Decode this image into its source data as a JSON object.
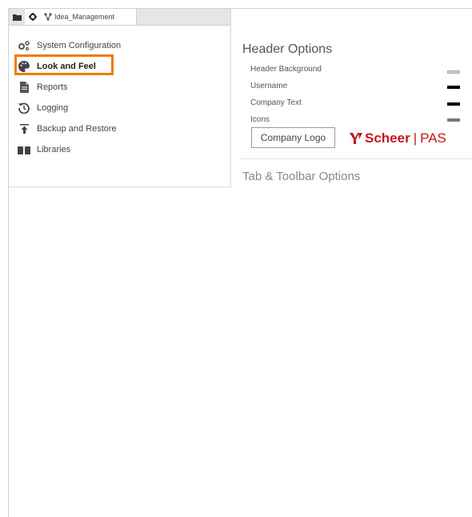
{
  "tabs": {
    "project_tab_label": "Idea_Management"
  },
  "sidebar": {
    "items": [
      {
        "label": "System Configuration",
        "icon": "gears-icon"
      },
      {
        "label": "Look and Feel",
        "icon": "palette-icon",
        "active": true
      },
      {
        "label": "Reports",
        "icon": "document-icon"
      },
      {
        "label": "Logging",
        "icon": "history-icon"
      },
      {
        "label": "Backup and Restore",
        "icon": "upload-icon"
      },
      {
        "label": "Libraries",
        "icon": "books-icon"
      }
    ]
  },
  "main": {
    "header_section_title": "Header Options",
    "options": [
      {
        "label": "Header Background",
        "color": "#c8c8c8"
      },
      {
        "label": "Username",
        "color": "#000000"
      },
      {
        "label": "Company Text",
        "color": "#000000"
      },
      {
        "label": "Icons",
        "color": "#777777"
      }
    ],
    "company_logo_button": "Company Logo",
    "brand": {
      "name": "Scheer",
      "suffix": "PAS",
      "color": "#c4161c"
    },
    "tab_section_title": "Tab & Toolbar Options"
  },
  "colors": {
    "highlight": "#ee7d00"
  }
}
